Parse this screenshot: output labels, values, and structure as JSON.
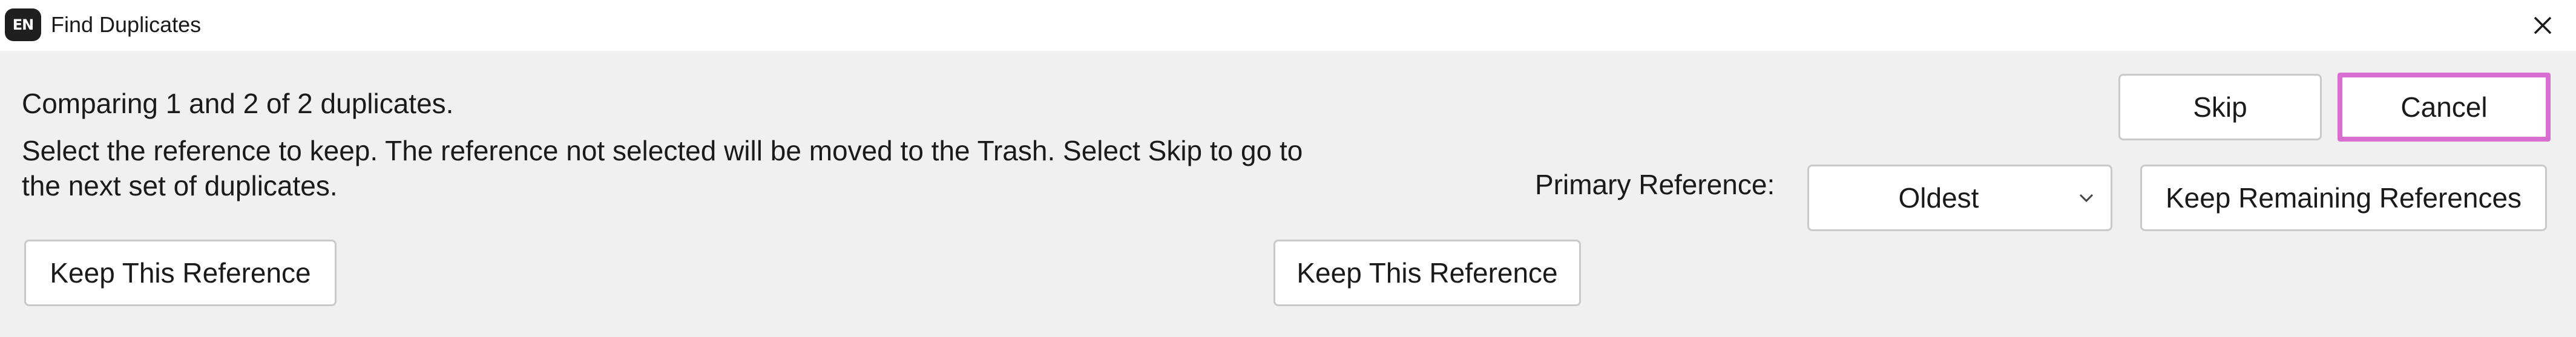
{
  "window": {
    "app_badge": "EN",
    "title": "Find Duplicates",
    "close_icon": "close-icon"
  },
  "status": {
    "comparing": "Comparing 1 and 2 of 2 duplicates.",
    "instructions_line1": "Select the reference to keep. The reference not selected will be moved to the Trash. Select Skip to go to",
    "instructions_line2": "the next set of duplicates."
  },
  "buttons": {
    "skip": "Skip",
    "cancel": "Cancel",
    "keep_remaining": "Keep Remaining References",
    "keep_left": "Keep This Reference",
    "keep_right": "Keep This Reference"
  },
  "primary_reference": {
    "label": "Primary Reference:",
    "selected": "Oldest",
    "icon": "chevron-down-icon"
  },
  "colors": {
    "focus_outline": "#d86fd0",
    "panel_background": "#f0f0f0"
  }
}
